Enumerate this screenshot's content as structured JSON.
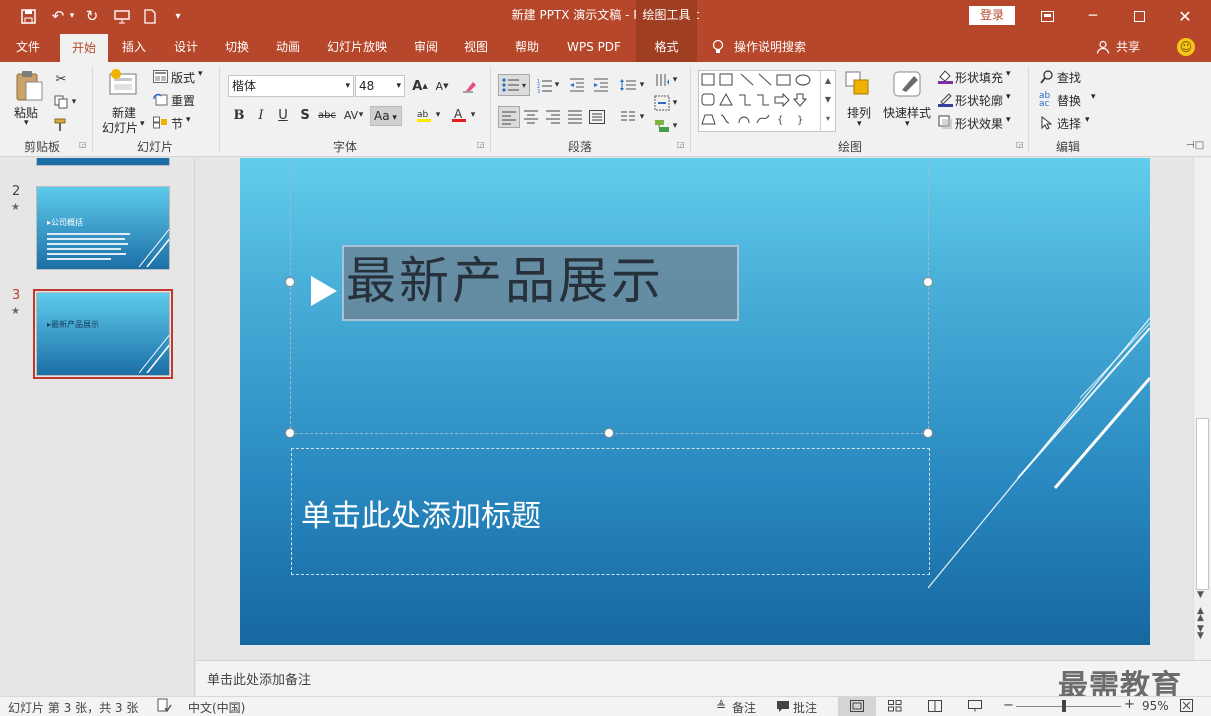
{
  "title_bar": {
    "title": "新建 PPTX 演示文稿  -  PowerPoint",
    "context_tools": "绘图工具",
    "login_label": "登录"
  },
  "tabs": [
    "文件",
    "开始",
    "插入",
    "设计",
    "切换",
    "动画",
    "幻灯片放映",
    "审阅",
    "视图",
    "帮助",
    "WPS PDF",
    "格式"
  ],
  "tell_me": "操作说明搜索",
  "share": "共享",
  "ribbon": {
    "clipboard": {
      "paste": "粘贴",
      "label": "剪贴板"
    },
    "slides": {
      "new_slide_1": "新建",
      "new_slide_2": "幻灯片",
      "layout": "版式",
      "reset": "重置",
      "section": "节",
      "label": "幻灯片"
    },
    "font": {
      "name": "楷体",
      "size": "48",
      "label": "字体",
      "case": "Aa"
    },
    "paragraph": {
      "label": "段落"
    },
    "drawing": {
      "arrange": "排列",
      "quick_styles": "快速样式",
      "fill": "形状填充",
      "outline": "形状轮廓",
      "effects": "形状效果",
      "label": "绘图"
    },
    "editing": {
      "find": "查找",
      "replace": "替换",
      "select": "选择",
      "label": "编辑"
    }
  },
  "thumbnails": [
    {
      "num": "2",
      "title": "公司概括"
    },
    {
      "num": "3",
      "title": "最新产品展示"
    }
  ],
  "slide": {
    "title": "最新产品展示",
    "subtitle_placeholder": "单击此处添加标题"
  },
  "notes_placeholder": "单击此处添加备注",
  "status": {
    "slide_info": "幻灯片 第 3 张，共 3 张",
    "language": "中文(中国)",
    "notes": "备注",
    "comments": "批注",
    "zoom": "95%",
    "zoom_level": 0.46
  },
  "watermark": "最需教育",
  "colors": {
    "accent": "#b7472a",
    "active_thumb": "#c0392b"
  }
}
